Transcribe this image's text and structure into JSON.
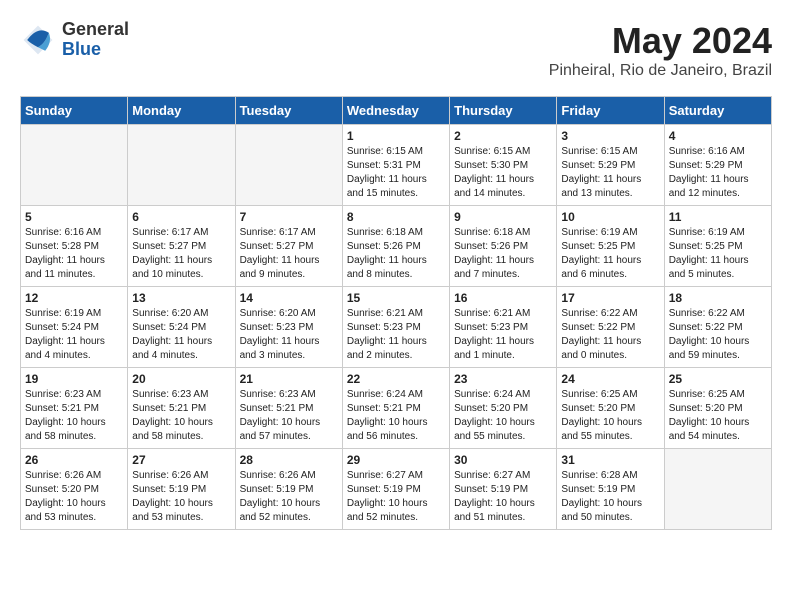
{
  "header": {
    "logo_line1": "General",
    "logo_line2": "Blue",
    "month_title": "May 2024",
    "location": "Pinheiral, Rio de Janeiro, Brazil"
  },
  "weekdays": [
    "Sunday",
    "Monday",
    "Tuesday",
    "Wednesday",
    "Thursday",
    "Friday",
    "Saturday"
  ],
  "weeks": [
    [
      {
        "day": "",
        "info": ""
      },
      {
        "day": "",
        "info": ""
      },
      {
        "day": "",
        "info": ""
      },
      {
        "day": "1",
        "info": "Sunrise: 6:15 AM\nSunset: 5:31 PM\nDaylight: 11 hours\nand 15 minutes."
      },
      {
        "day": "2",
        "info": "Sunrise: 6:15 AM\nSunset: 5:30 PM\nDaylight: 11 hours\nand 14 minutes."
      },
      {
        "day": "3",
        "info": "Sunrise: 6:15 AM\nSunset: 5:29 PM\nDaylight: 11 hours\nand 13 minutes."
      },
      {
        "day": "4",
        "info": "Sunrise: 6:16 AM\nSunset: 5:29 PM\nDaylight: 11 hours\nand 12 minutes."
      }
    ],
    [
      {
        "day": "5",
        "info": "Sunrise: 6:16 AM\nSunset: 5:28 PM\nDaylight: 11 hours\nand 11 minutes."
      },
      {
        "day": "6",
        "info": "Sunrise: 6:17 AM\nSunset: 5:27 PM\nDaylight: 11 hours\nand 10 minutes."
      },
      {
        "day": "7",
        "info": "Sunrise: 6:17 AM\nSunset: 5:27 PM\nDaylight: 11 hours\nand 9 minutes."
      },
      {
        "day": "8",
        "info": "Sunrise: 6:18 AM\nSunset: 5:26 PM\nDaylight: 11 hours\nand 8 minutes."
      },
      {
        "day": "9",
        "info": "Sunrise: 6:18 AM\nSunset: 5:26 PM\nDaylight: 11 hours\nand 7 minutes."
      },
      {
        "day": "10",
        "info": "Sunrise: 6:19 AM\nSunset: 5:25 PM\nDaylight: 11 hours\nand 6 minutes."
      },
      {
        "day": "11",
        "info": "Sunrise: 6:19 AM\nSunset: 5:25 PM\nDaylight: 11 hours\nand 5 minutes."
      }
    ],
    [
      {
        "day": "12",
        "info": "Sunrise: 6:19 AM\nSunset: 5:24 PM\nDaylight: 11 hours\nand 4 minutes."
      },
      {
        "day": "13",
        "info": "Sunrise: 6:20 AM\nSunset: 5:24 PM\nDaylight: 11 hours\nand 4 minutes."
      },
      {
        "day": "14",
        "info": "Sunrise: 6:20 AM\nSunset: 5:23 PM\nDaylight: 11 hours\nand 3 minutes."
      },
      {
        "day": "15",
        "info": "Sunrise: 6:21 AM\nSunset: 5:23 PM\nDaylight: 11 hours\nand 2 minutes."
      },
      {
        "day": "16",
        "info": "Sunrise: 6:21 AM\nSunset: 5:23 PM\nDaylight: 11 hours\nand 1 minute."
      },
      {
        "day": "17",
        "info": "Sunrise: 6:22 AM\nSunset: 5:22 PM\nDaylight: 11 hours\nand 0 minutes."
      },
      {
        "day": "18",
        "info": "Sunrise: 6:22 AM\nSunset: 5:22 PM\nDaylight: 10 hours\nand 59 minutes."
      }
    ],
    [
      {
        "day": "19",
        "info": "Sunrise: 6:23 AM\nSunset: 5:21 PM\nDaylight: 10 hours\nand 58 minutes."
      },
      {
        "day": "20",
        "info": "Sunrise: 6:23 AM\nSunset: 5:21 PM\nDaylight: 10 hours\nand 58 minutes."
      },
      {
        "day": "21",
        "info": "Sunrise: 6:23 AM\nSunset: 5:21 PM\nDaylight: 10 hours\nand 57 minutes."
      },
      {
        "day": "22",
        "info": "Sunrise: 6:24 AM\nSunset: 5:21 PM\nDaylight: 10 hours\nand 56 minutes."
      },
      {
        "day": "23",
        "info": "Sunrise: 6:24 AM\nSunset: 5:20 PM\nDaylight: 10 hours\nand 55 minutes."
      },
      {
        "day": "24",
        "info": "Sunrise: 6:25 AM\nSunset: 5:20 PM\nDaylight: 10 hours\nand 55 minutes."
      },
      {
        "day": "25",
        "info": "Sunrise: 6:25 AM\nSunset: 5:20 PM\nDaylight: 10 hours\nand 54 minutes."
      }
    ],
    [
      {
        "day": "26",
        "info": "Sunrise: 6:26 AM\nSunset: 5:20 PM\nDaylight: 10 hours\nand 53 minutes."
      },
      {
        "day": "27",
        "info": "Sunrise: 6:26 AM\nSunset: 5:19 PM\nDaylight: 10 hours\nand 53 minutes."
      },
      {
        "day": "28",
        "info": "Sunrise: 6:26 AM\nSunset: 5:19 PM\nDaylight: 10 hours\nand 52 minutes."
      },
      {
        "day": "29",
        "info": "Sunrise: 6:27 AM\nSunset: 5:19 PM\nDaylight: 10 hours\nand 52 minutes."
      },
      {
        "day": "30",
        "info": "Sunrise: 6:27 AM\nSunset: 5:19 PM\nDaylight: 10 hours\nand 51 minutes."
      },
      {
        "day": "31",
        "info": "Sunrise: 6:28 AM\nSunset: 5:19 PM\nDaylight: 10 hours\nand 50 minutes."
      },
      {
        "day": "",
        "info": ""
      }
    ]
  ]
}
